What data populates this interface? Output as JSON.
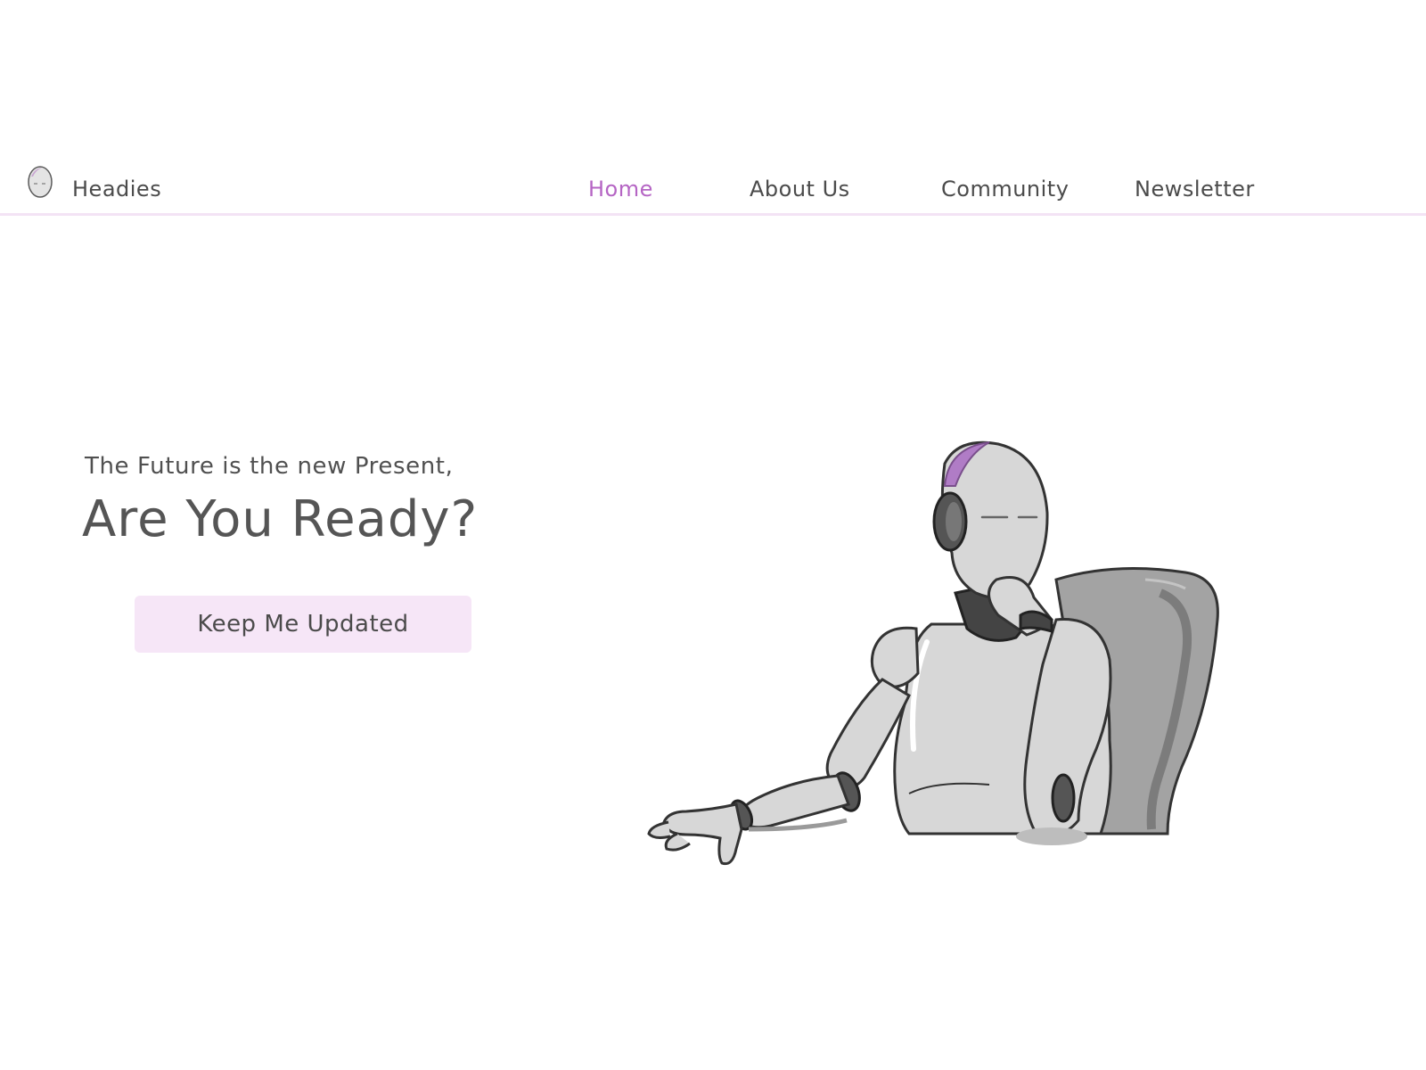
{
  "header": {
    "brand": "Headies",
    "logo_icon": "robot-head-icon",
    "nav": [
      {
        "label": "Home",
        "active": true
      },
      {
        "label": "About Us",
        "active": false
      },
      {
        "label": "Community",
        "active": false
      },
      {
        "label": "Newsletter",
        "active": false
      }
    ]
  },
  "hero": {
    "subtitle": "The Future is the new Present,",
    "title": "Are You Ready?",
    "cta_label": "Keep Me Updated",
    "illustration": "thinking-robot-in-chair"
  },
  "colors": {
    "accent": "#b565c4",
    "button_bg": "#f6e6f7",
    "divider": "#f3e3f5",
    "text": "#4b4b4b"
  }
}
